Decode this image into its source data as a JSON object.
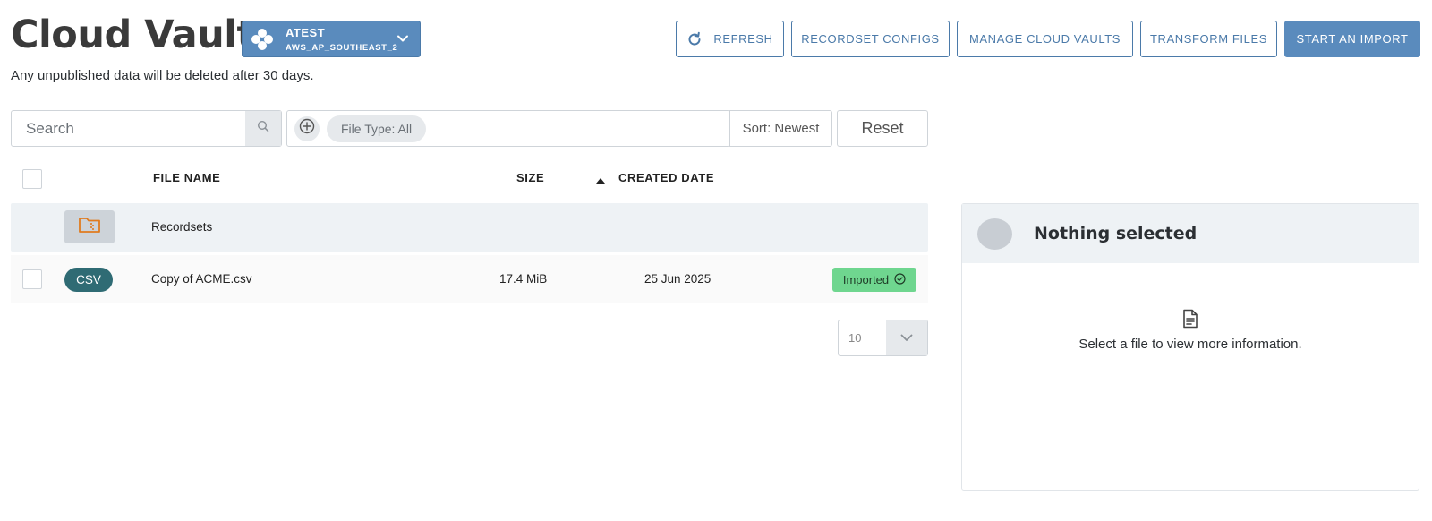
{
  "header": {
    "title": "Cloud Vault",
    "subtitle": "Any unpublished data will be deleted after 30 days."
  },
  "vault": {
    "name": "ATEST",
    "region": "AWS_AP_SOUTHEAST_2"
  },
  "toolbar": {
    "refresh": "REFRESH",
    "recordset_configs": "RECORDSET CONFIGS",
    "manage_cloud_vaults": "MANAGE CLOUD VAULTS",
    "transform_files": "TRANSFORM FILES",
    "start_import": "START AN IMPORT"
  },
  "filters": {
    "search_placeholder": "Search",
    "file_type_chip": "File Type: All",
    "sort": "Sort: Newest",
    "reset": "Reset"
  },
  "table": {
    "columns": {
      "file_name": "FILE NAME",
      "size": "SIZE",
      "created_date": "CREATED DATE"
    },
    "folder": {
      "name": "Recordsets"
    },
    "rows": [
      {
        "type": "CSV",
        "name": "Copy of ACME.csv",
        "size": "17.4 MiB",
        "created": "25 Jun 2025",
        "status": "Imported"
      }
    ]
  },
  "pagination": {
    "page_size": "10"
  },
  "details_panel": {
    "title": "Nothing selected",
    "empty_message": "Select a file to view more information."
  },
  "colors": {
    "primary": "#5a8bbd",
    "csv_badge": "#2f6b74",
    "status_imported": "#6fd68f",
    "folder_icon": "#e07b1f"
  }
}
